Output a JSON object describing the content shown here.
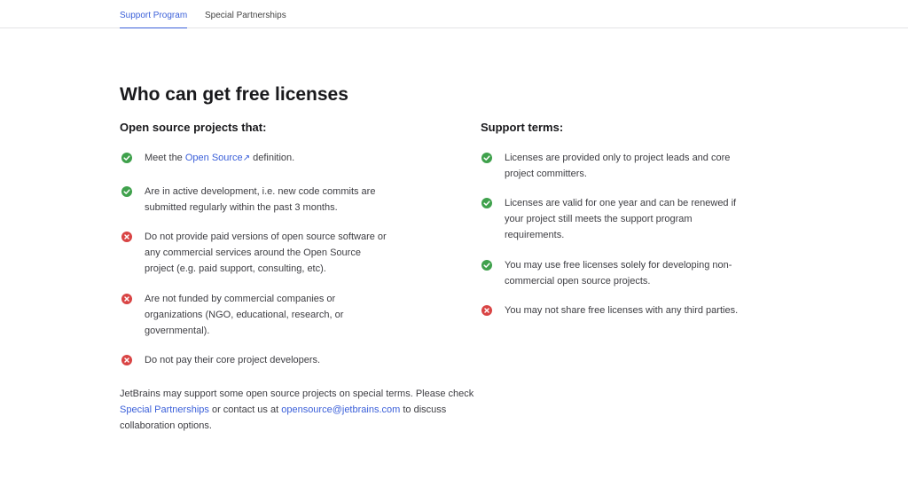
{
  "tabs": [
    {
      "label": "Support Program",
      "active": true
    },
    {
      "label": "Special Partnerships",
      "active": false
    }
  ],
  "title": "Who can get free licenses",
  "left": {
    "heading": "Open source projects that:",
    "item1": {
      "pre": "Meet the ",
      "link": "Open Source",
      "arrow": "↗",
      "post": " definition."
    },
    "items": [
      {
        "status": "check",
        "text": "Meet the Open Source definition."
      },
      {
        "status": "check",
        "lines": [
          "Are in active development, i.e. new code commits are",
          "submitted regularly within the past 3 months."
        ]
      },
      {
        "status": "cross",
        "lines": [
          "Do not provide paid versions of open source software or",
          "any commercial services around the Open Source",
          "project (e.g. paid support, consulting, etc)."
        ]
      },
      {
        "status": "cross",
        "lines": [
          "Are not funded by commercial companies or",
          "organizations (NGO, educational, research, or",
          "governmental)."
        ]
      },
      {
        "status": "cross",
        "lines": [
          "Do not pay their core project developers."
        ]
      }
    ]
  },
  "right": {
    "heading": "Support terms:",
    "items": [
      {
        "status": "check",
        "lines": [
          "Licenses are provided only to project leads and core",
          "project committers."
        ]
      },
      {
        "status": "check",
        "lines": [
          "Licenses are valid for one year and can be renewed if",
          "your project still meets the support program",
          "requirements."
        ]
      },
      {
        "status": "check",
        "lines": [
          "You may use free licenses solely for developing non-",
          "commercial open source projects."
        ]
      },
      {
        "status": "cross",
        "lines": [
          "You may not share free licenses with any third parties."
        ]
      }
    ]
  },
  "note": {
    "part1": "JetBrains may support some open source projects on special terms. Please check",
    "link1": "Special Partnerships",
    "part2": " or contact us at ",
    "link2": "opensource@jetbrains.com",
    "part3": " to discuss",
    "part4": "collaboration options."
  },
  "colors": {
    "accent": "#3a5fd9",
    "check": "#3fa14c",
    "cross": "#d94444"
  },
  "icons": {
    "check": "check-circle-icon",
    "cross": "cross-circle-icon"
  }
}
